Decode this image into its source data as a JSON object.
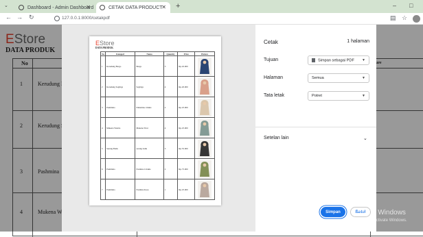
{
  "browser": {
    "tabs": [
      {
        "title": "Dashboard - Admin Dashboard",
        "active": false
      },
      {
        "title": "CETAK DATA PRODUCT",
        "active": true
      }
    ],
    "url": "127.0.0.1:8000/cetakpdf",
    "controls": {
      "minimize": "–",
      "maximize": "□",
      "close": "✕"
    }
  },
  "background_page": {
    "logo": {
      "accent": "E",
      "rest": "Store"
    },
    "title": "DATA PRODUK",
    "table_header_no": "No",
    "table_header_right": "ure",
    "rows": [
      {
        "no": "1",
        "name": "Kerudung Ba"
      },
      {
        "no": "2",
        "name": "Kerudung Se"
      },
      {
        "no": "3",
        "name": "Pashmina"
      },
      {
        "no": "4",
        "name": "Mukena Wa"
      }
    ]
  },
  "preview": {
    "logo": {
      "accent": "E",
      "rest": "Store"
    },
    "title": "DATA PRODUK",
    "headers": [
      "No",
      "Kategori",
      "Nama",
      "Quantity",
      "Price",
      "Picture"
    ],
    "rows": [
      {
        "no": "1",
        "kategori": "Kerudung Bergo",
        "nama": "Bergo",
        "qty": "3",
        "price": "Rp.45.000",
        "pic_color": "#1f3b6b"
      },
      {
        "no": "2",
        "kategori": "Kerudung Segitiga",
        "nama": "Segitiga",
        "qty": "4",
        "price": "Rp.20.000",
        "pic_color": "#d79b84"
      },
      {
        "no": "3",
        "kategori": "Pashmina",
        "nama": "Pahsmina crinkle",
        "qty": "2",
        "price": "Rp.25.000",
        "pic_color": "#d9c4a9"
      },
      {
        "no": "4",
        "kategori": "Mukena Wanita",
        "nama": "Mukena Tirai",
        "qty": "4",
        "price": "Rp.25.000",
        "pic_color": "#7d968f"
      },
      {
        "no": "5",
        "kategori": "Sarung Batik",
        "nama": "sarung batik",
        "qty": "3",
        "price": "Rp.55.000",
        "pic_color": "#2b2b2b"
      },
      {
        "no": "6",
        "kategori": "Pashmina",
        "nama": "Pasmina Crinkle",
        "qty": "2",
        "price": "Rp.75.000",
        "pic_color": "#7c8a4e"
      },
      {
        "no": "7",
        "kategori": "Pashmina",
        "nama": "Pasmina Kaos",
        "qty": "1",
        "price": "Rp.25.000",
        "pic_color": "#b6a49a"
      }
    ]
  },
  "print_panel": {
    "title": "Cetak",
    "page_count": "1 halaman",
    "destination": {
      "label": "Tujuan",
      "value": "Simpan sebagai PDF"
    },
    "pages": {
      "label": "Halaman",
      "value": "Semua"
    },
    "layout": {
      "label": "Tata letak",
      "value": "Potret"
    },
    "more_settings": "Setelan lain",
    "save_button": "Simpan",
    "cancel_button": "Batal"
  },
  "watermark": {
    "line1": "Activate Windows",
    "line2": "Go to Settings to activate Windows."
  },
  "colors": {
    "accent_blue": "#1a73e8",
    "brand_red": "#e83e2b",
    "tabbar": "#d3e3d0"
  }
}
